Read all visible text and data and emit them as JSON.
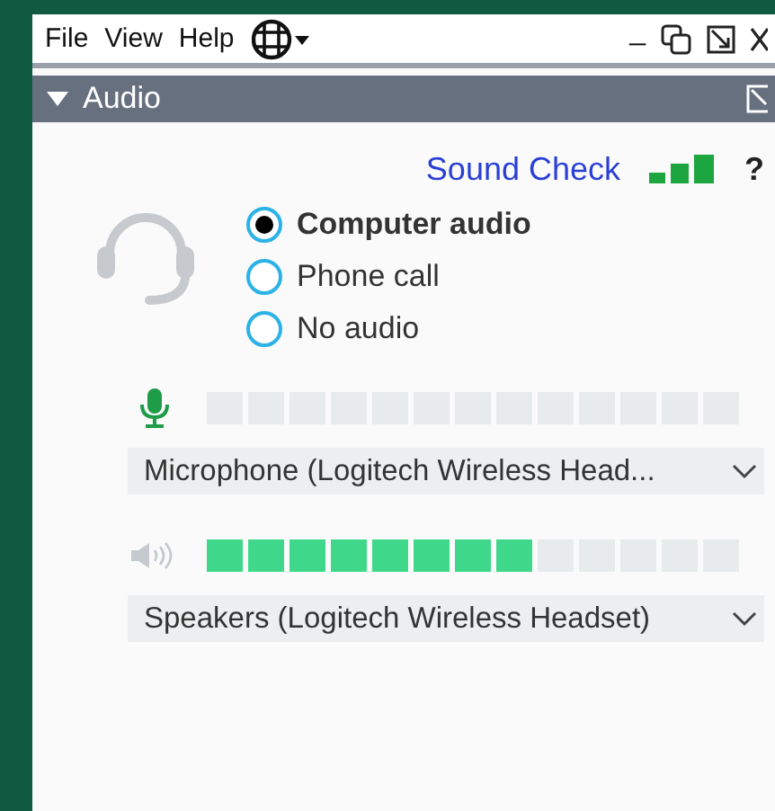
{
  "menu": [
    "File",
    "View",
    "Help"
  ],
  "window_controls": [
    "_"
  ],
  "section": {
    "title": "Audio",
    "expanded": true
  },
  "sound_check": {
    "label": "Sound Check",
    "help": "?"
  },
  "audio_options": [
    {
      "label": "Computer audio",
      "selected": true
    },
    {
      "label": "Phone call",
      "selected": false
    },
    {
      "label": "No audio",
      "selected": false
    }
  ],
  "devices": [
    {
      "kind": "microphone",
      "device": "Microphone (Logitech Wireless Head..."
    },
    {
      "kind": "speaker",
      "level": 0.615,
      "device": "Speakers (Logitech Wireless Headset)"
    }
  ]
}
